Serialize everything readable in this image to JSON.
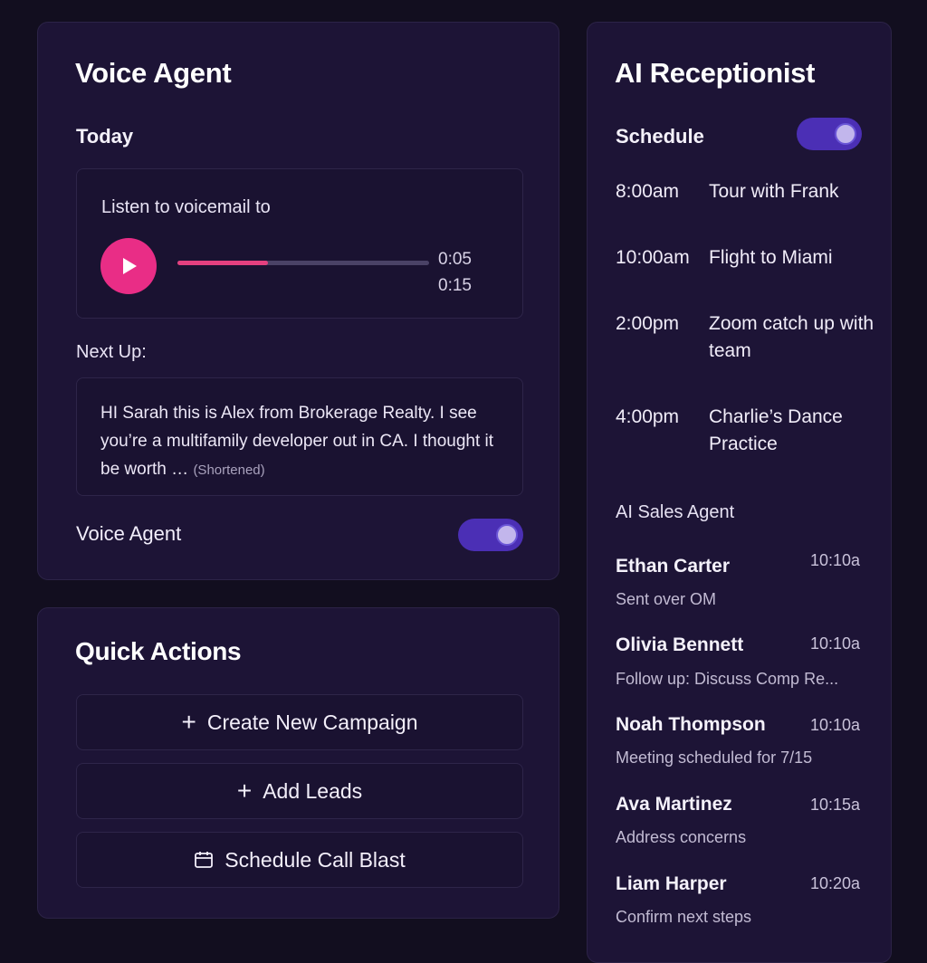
{
  "voice_agent": {
    "title": "Voice Agent",
    "today_label": "Today",
    "voicemail": {
      "label": "Listen to voicemail to",
      "elapsed": "0:05",
      "duration": "0:15",
      "progress_fraction": 0.36
    },
    "next_up_label": "Next Up:",
    "next_up_text": "HI Sarah this is Alex from Brokerage Realty. I see you’re a multifamily developer out in CA. I thought it be worth …",
    "next_up_note": "(Shortened)",
    "toggle_label": "Voice Agent",
    "toggle_on": true
  },
  "quick_actions": {
    "title": "Quick Actions",
    "buttons": [
      {
        "icon": "plus-icon",
        "label": "Create New Campaign"
      },
      {
        "icon": "plus-icon",
        "label": "Add Leads"
      },
      {
        "icon": "calendar-icon",
        "label": "Schedule Call Blast"
      }
    ]
  },
  "receptionist": {
    "title": "AI Receptionist",
    "schedule_label": "Schedule",
    "schedule_on": true,
    "schedule": [
      {
        "time": "8:00am",
        "title": "Tour with Frank"
      },
      {
        "time": "10:00am",
        "title": "Flight to Miami"
      },
      {
        "time": "2:00pm",
        "title": "Zoom catch up with team"
      },
      {
        "time": "4:00pm",
        "title": "Charlie’s Dance Practice"
      }
    ],
    "sales_agent_label": "AI Sales Agent",
    "leads": [
      {
        "name": "Ethan Carter",
        "time": "10:10a",
        "note": "Sent over OM"
      },
      {
        "name": "Olivia Bennett",
        "time": "10:10a",
        "note": "Follow up: Discuss Comp Re..."
      },
      {
        "name": "Noah Thompson",
        "time": "10:10a",
        "note": "Meeting scheduled for 7/15"
      },
      {
        "name": "Ava Martinez",
        "time": "10:15a",
        "note": "Address concerns"
      },
      {
        "name": "Liam Harper",
        "time": "10:20a",
        "note": "Confirm next steps"
      }
    ]
  },
  "colors": {
    "background": "#120e1f",
    "card": "#1d1436",
    "accent_pink": "#e92d86",
    "toggle_purple": "#4b2fb5"
  }
}
